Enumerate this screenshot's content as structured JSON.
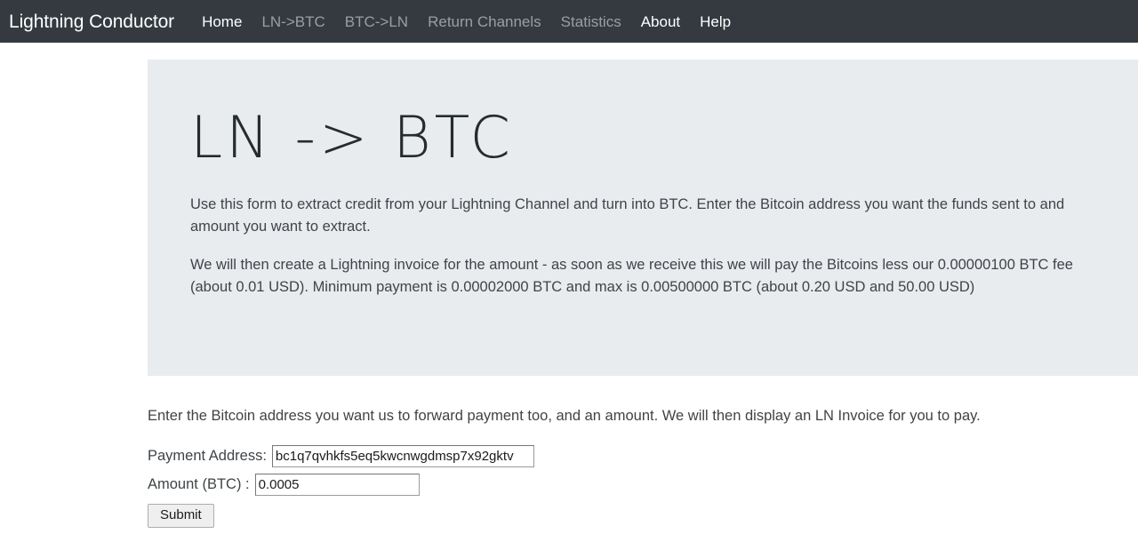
{
  "navbar": {
    "brand": "Lightning Conductor",
    "items": [
      {
        "label": "Home",
        "active": true
      },
      {
        "label": "LN->BTC",
        "active": false
      },
      {
        "label": "BTC->LN",
        "active": false
      },
      {
        "label": "Return Channels",
        "active": false
      },
      {
        "label": "Statistics",
        "active": false
      },
      {
        "label": "About",
        "active": true
      },
      {
        "label": "Help",
        "active": true
      }
    ]
  },
  "jumbotron": {
    "title": "LN -> BTC",
    "paragraph1": "Use this form to extract credit from your Lightning Channel and turn into BTC. Enter the Bitcoin address you want the funds sent to and amount you want to extract.",
    "paragraph2": "We will then create a Lightning invoice for the amount - as soon as we receive this we will pay the Bitcoins less our 0.00000100 BTC fee (about 0.01 USD). Minimum payment is 0.00002000 BTC and max is 0.00500000 BTC (about 0.20 USD and 50.00 USD)",
    "background_color": "#e9ecef"
  },
  "form": {
    "lead": "Enter the Bitcoin address you want us to forward payment too, and an amount. We will then display an LN Invoice for you to pay.",
    "address_label": "Payment Address:",
    "address_value": "bc1q7qvhkfs5eq5kwcnwgdmsp7x92gktv",
    "address_placeholder": "",
    "amount_label": "Amount (BTC) :",
    "amount_value": "0.0005",
    "amount_placeholder": "",
    "submit_label": "Submit"
  },
  "colors": {
    "navbar_bg": "#343a40",
    "nav_active": "#ffffff",
    "nav_muted": "rgba(255,255,255,0.5)",
    "body_text": "#3f4448"
  }
}
